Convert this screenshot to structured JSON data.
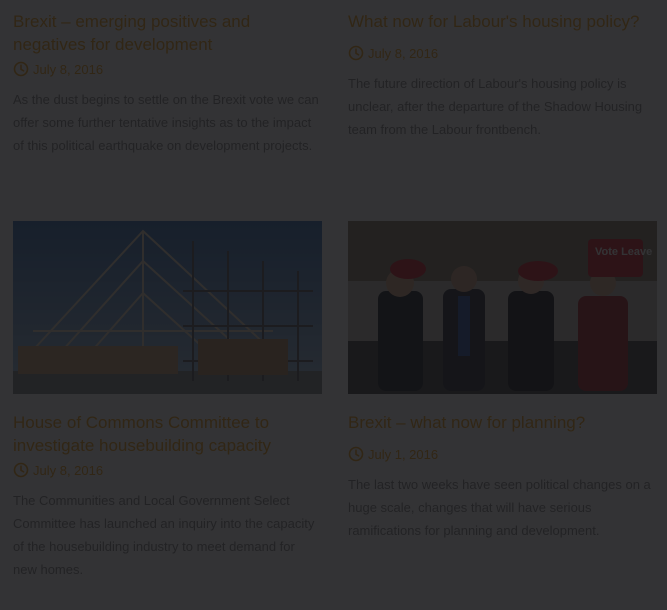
{
  "theme": {
    "accent": "#f0a31e",
    "text_muted": "#8a8a8a",
    "overlay": "#121214"
  },
  "posts": [
    {
      "title": "Brexit – emerging positives and negatives for development",
      "date": "July 8, 2016",
      "icon": "clock-icon",
      "excerpt": "As the dust begins to settle on the Brexit vote we can offer some further tentative insights as to the impact of this political earthquake on development projects."
    },
    {
      "title": "What now for Labour's housing policy?",
      "date": "July 8, 2016",
      "icon": "clock-icon",
      "excerpt": "The future direction of Labour's housing policy is unclear, after the departure of the Shadow Housing team from the Labour frontbench."
    },
    {
      "title": "House of Commons Committee to investigate housebuilding capacity",
      "date": "July 8, 2016",
      "icon": "clock-icon",
      "excerpt": "The Communities and Local Government Select Committee has launched an inquiry into the capacity of the housebuilding industry to meet demand for new homes."
    },
    {
      "title": "Brexit – what now for planning?",
      "date": "July 1, 2016",
      "icon": "clock-icon",
      "excerpt": "The last two weeks have seen political changes on a huge scale, changes that will have serious ramifications for planning and development.",
      "image_sign_text": "Vote Leave"
    }
  ]
}
